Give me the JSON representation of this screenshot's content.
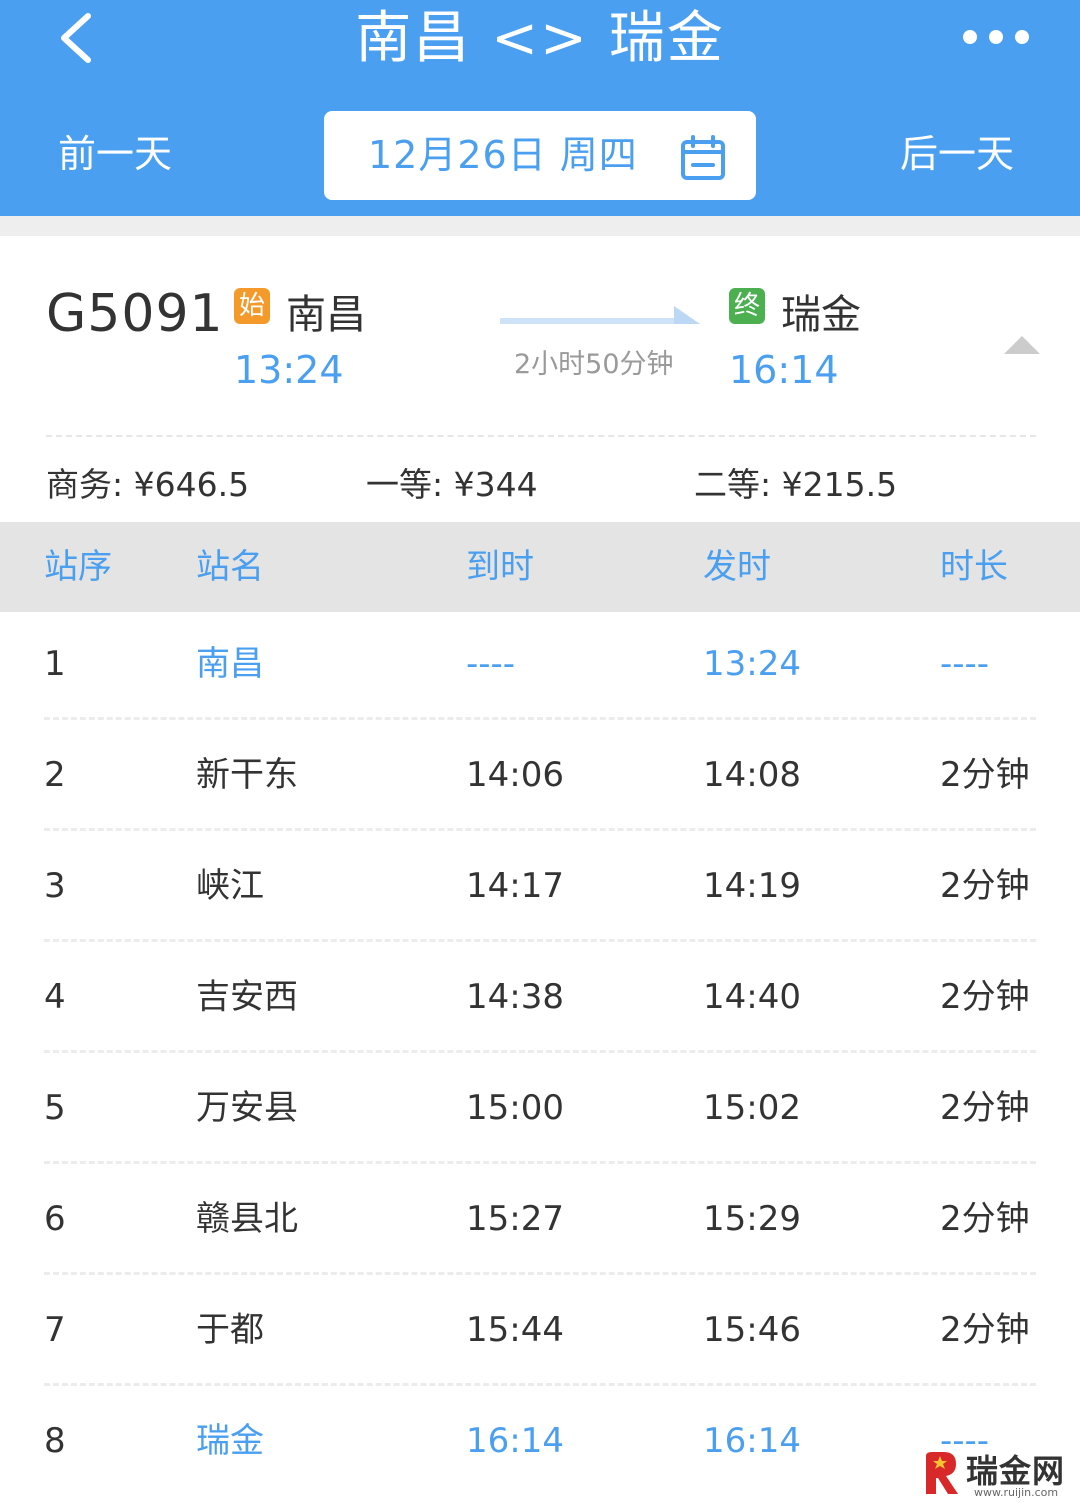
{
  "header": {
    "title": "南昌 <> 瑞金",
    "back_icon": "chevron-left-icon",
    "more_icon": "more-dots-icon",
    "prev_day": "前一天",
    "next_day": "后一天",
    "date": "12月26日 周四",
    "calendar_icon": "calendar-icon",
    "bg_color": "#4a9ff0"
  },
  "train": {
    "number": "G5091",
    "start_badge": "始",
    "end_badge": "终",
    "from_station": "南昌",
    "to_station": "瑞金",
    "depart_time": "13:24",
    "arrive_time": "16:14",
    "duration": "2小时50分钟",
    "prices": {
      "business": "商务: ¥646.5",
      "first": "一等: ¥344",
      "second": "二等: ¥215.5"
    }
  },
  "table": {
    "headers": [
      "站序",
      "站名",
      "到时",
      "发时",
      "时长"
    ],
    "rows": [
      {
        "seq": "1",
        "station": "南昌",
        "arrive": "----",
        "depart": "13:24",
        "stop": "----",
        "highlight": true
      },
      {
        "seq": "2",
        "station": "新干东",
        "arrive": "14:06",
        "depart": "14:08",
        "stop": "2分钟",
        "highlight": false
      },
      {
        "seq": "3",
        "station": "峡江",
        "arrive": "14:17",
        "depart": "14:19",
        "stop": "2分钟",
        "highlight": false
      },
      {
        "seq": "4",
        "station": "吉安西",
        "arrive": "14:38",
        "depart": "14:40",
        "stop": "2分钟",
        "highlight": false
      },
      {
        "seq": "5",
        "station": "万安县",
        "arrive": "15:00",
        "depart": "15:02",
        "stop": "2分钟",
        "highlight": false
      },
      {
        "seq": "6",
        "station": "赣县北",
        "arrive": "15:27",
        "depart": "15:29",
        "stop": "2分钟",
        "highlight": false
      },
      {
        "seq": "7",
        "station": "于都",
        "arrive": "15:44",
        "depart": "15:46",
        "stop": "2分钟",
        "highlight": false
      },
      {
        "seq": "8",
        "station": "瑞金",
        "arrive": "16:14",
        "depart": "16:14",
        "stop": "----",
        "highlight": true
      }
    ]
  },
  "watermark": {
    "text": "瑞金网",
    "url": "www.ruijin.com"
  },
  "colors": {
    "accent": "#4a9ff0",
    "start_badge": "#f39a2b",
    "end_badge": "#4caf50"
  }
}
